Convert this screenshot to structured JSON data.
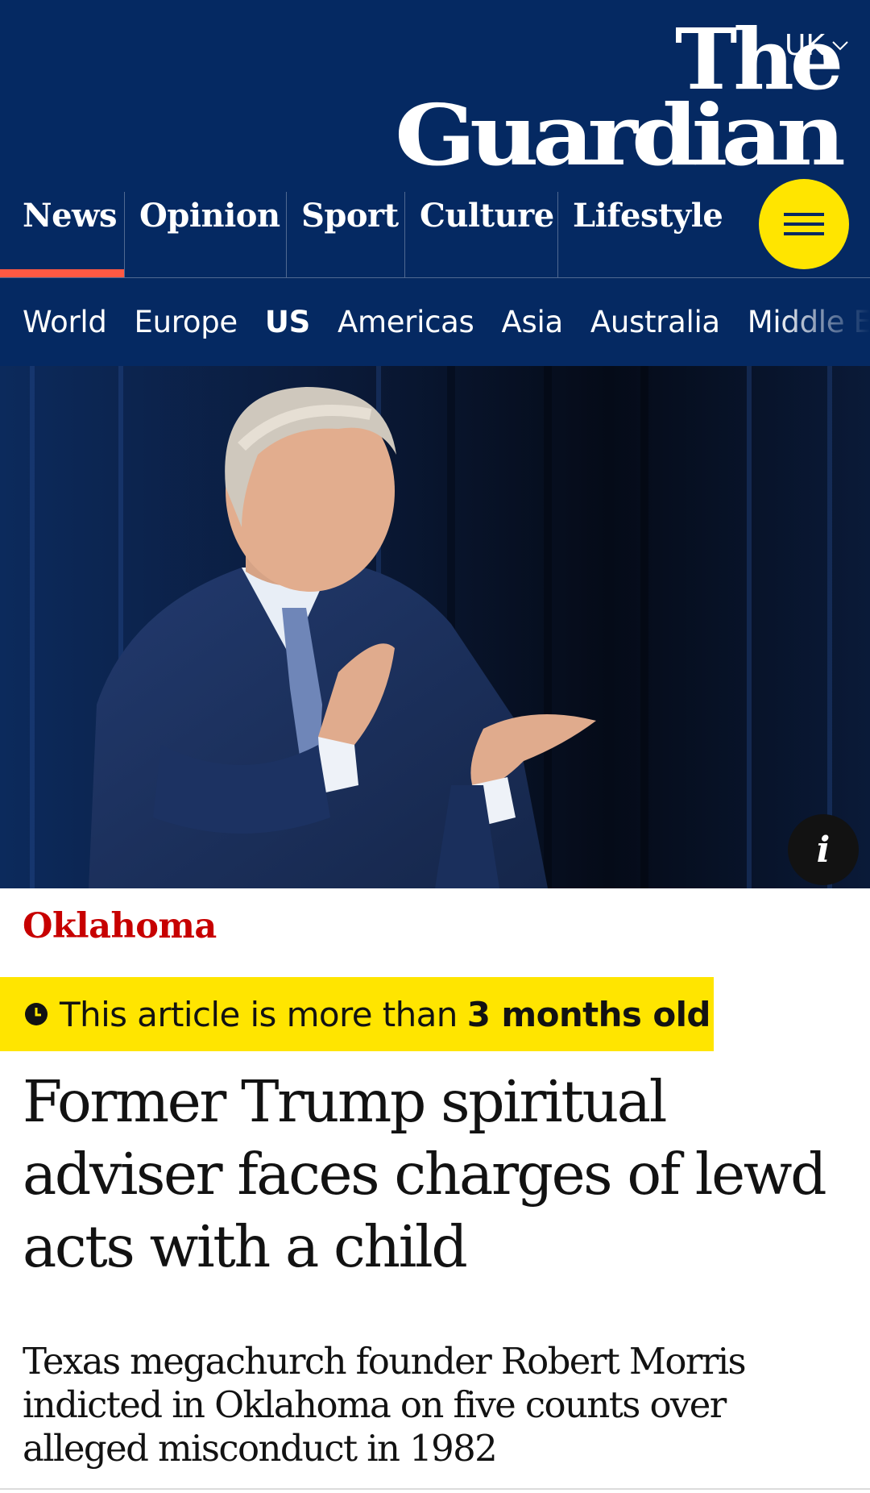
{
  "header": {
    "edition": "UK",
    "logo_line1": "The",
    "logo_line2": "Guardian",
    "pillars": [
      {
        "label": "News",
        "active": true
      },
      {
        "label": "Opinion"
      },
      {
        "label": "Sport"
      },
      {
        "label": "Culture"
      },
      {
        "label": "Lifestyle"
      }
    ],
    "menu_icon": "hamburger-icon"
  },
  "subnav": {
    "items": [
      {
        "label": "World"
      },
      {
        "label": "Europe"
      },
      {
        "label": "US",
        "active": true
      },
      {
        "label": "Americas"
      },
      {
        "label": "Asia"
      },
      {
        "label": "Australia"
      },
      {
        "label": "Middle East"
      }
    ]
  },
  "article": {
    "series": "Oklahoma",
    "age_warning_prefix": "This article is more than",
    "age_warning_bold": "3 months old",
    "headline": "Former Trump spiritual adviser faces charges of lewd acts with a child",
    "standfirst": "Texas megachurch founder Robert Morris indicted in Oklahoma on five counts over alleged misconduct in 1982",
    "image_info_icon": "i"
  },
  "colors": {
    "brand_blue": "#052962",
    "news_red": "#c70000",
    "highlight_yellow": "#ffe500",
    "active_underline": "#ff5943"
  }
}
